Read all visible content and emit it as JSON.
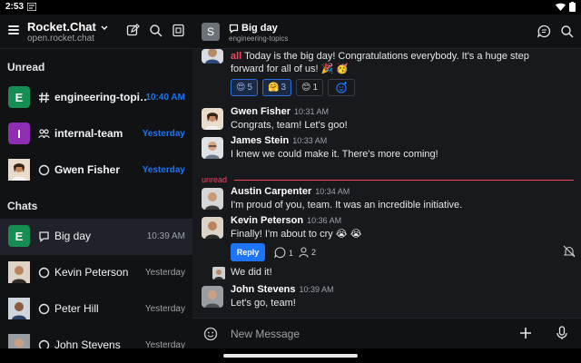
{
  "status": {
    "time": "2:53"
  },
  "sidebar": {
    "workspace_name": "Rocket.Chat",
    "workspace_url": "open.rocket.chat",
    "unread_title": "Unread",
    "chats_title": "Chats",
    "unread": [
      {
        "letter": "E",
        "color": "#158d53",
        "type": "channel",
        "name": "engineering-topi…",
        "time": "10:40 AM"
      },
      {
        "letter": "I",
        "color": "#8f2db5",
        "type": "team",
        "name": "internal-team",
        "time": "Yesterday"
      },
      {
        "letter": "",
        "color": "#d4b596",
        "type": "dm",
        "name": "Gwen Fisher",
        "time": "Yesterday"
      }
    ],
    "chats": [
      {
        "letter": "E",
        "color": "#158d53",
        "type": "discussion",
        "name": "Big day",
        "time": "10:39 AM"
      },
      {
        "letter": "",
        "color": "#c9a37e",
        "type": "dm",
        "name": "Kevin Peterson",
        "time": "Yesterday"
      },
      {
        "letter": "",
        "color": "#3b4d6b",
        "type": "dm",
        "name": "Peter Hill",
        "time": "Yesterday"
      },
      {
        "letter": "",
        "color": "#6b6e72",
        "type": "dm",
        "name": "John Stevens",
        "time": "Yesterday"
      }
    ]
  },
  "chat": {
    "avatar_letter": "S",
    "title": "Big day",
    "subtitle": "engineering-topics",
    "messages": [
      {
        "mention": "all",
        "text1": " Today is the big day! Congratulations everybody. It's a huge step",
        "text2": "forward for all of us! 🎉 🥳"
      },
      {
        "name": "Gwen Fisher",
        "time": "10:31 AM",
        "text": "Congrats, team! Let's goo!"
      },
      {
        "name": "James Stein",
        "time": "10:33 AM",
        "text": "I knew we could make it. There's more coming!"
      },
      {
        "name": "Austin Carpenter",
        "time": "10:34 AM",
        "text": "I'm proud of you, team. It was an incredible initiative."
      },
      {
        "name": "Kevin Peterson",
        "time": "10:36 AM",
        "text": "Finally! I'm about to cry 😭 😭"
      },
      {
        "text": "We did it!"
      },
      {
        "name": "John Stevens",
        "time": "10:39 AM",
        "text": "Let's go, team!"
      }
    ],
    "reactions": [
      {
        "emoji": "😍",
        "count": "5"
      },
      {
        "emoji": "🤗",
        "count": "3"
      },
      {
        "emoji": "😊",
        "count": "1"
      }
    ],
    "unread_label": "unread",
    "reply_label": "Reply",
    "thread_replies": "1",
    "thread_participants": "2",
    "composer_placeholder": "New Message"
  },
  "colors": {
    "accent": "#1d74f5",
    "danger": "#f5455c",
    "sidebar_bg": "#111214",
    "chat_bg": "#18191c"
  }
}
